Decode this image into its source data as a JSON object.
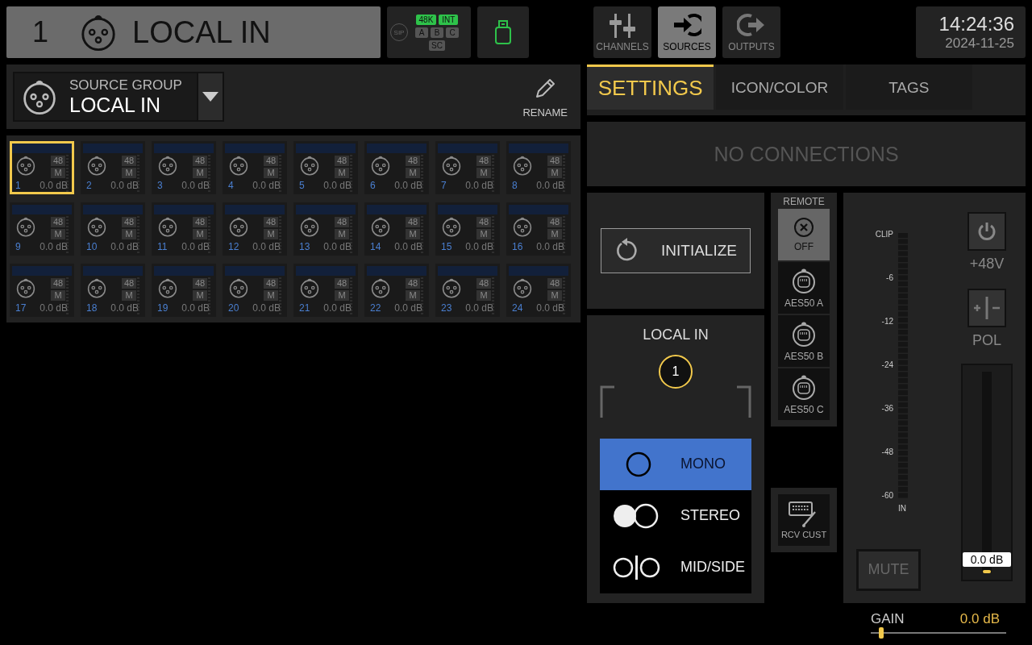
{
  "header": {
    "channel_number": "1",
    "channel_name": "LOCAL IN"
  },
  "status": {
    "sip": "SIP",
    "badges": [
      {
        "label": "48K",
        "on": true
      },
      {
        "label": "INT",
        "on": true
      },
      {
        "label": "A",
        "on": false
      },
      {
        "label": "B",
        "on": false
      },
      {
        "label": "C",
        "on": false
      },
      {
        "label": "SC",
        "on": false
      }
    ]
  },
  "nav": [
    {
      "label": "CHANNELS",
      "kind": "channels",
      "selected": false
    },
    {
      "label": "SOURCES",
      "kind": "sources",
      "selected": true
    },
    {
      "label": "OUTPUTS",
      "kind": "outputs",
      "selected": false
    }
  ],
  "clock": {
    "time": "14:24:36",
    "date": "2024-11-25"
  },
  "source_group": {
    "caption": "SOURCE GROUP",
    "value": "LOCAL IN",
    "rename": "RENAME"
  },
  "inputs": [
    {
      "number": "1",
      "phantom": "48",
      "mode": "M",
      "gain": "0.0 dB",
      "selected": true
    },
    {
      "number": "2",
      "phantom": "48",
      "mode": "M",
      "gain": "0.0 dB",
      "selected": false
    },
    {
      "number": "3",
      "phantom": "48",
      "mode": "M",
      "gain": "0.0 dB",
      "selected": false
    },
    {
      "number": "4",
      "phantom": "48",
      "mode": "M",
      "gain": "0.0 dB",
      "selected": false
    },
    {
      "number": "5",
      "phantom": "48",
      "mode": "M",
      "gain": "0.0 dB",
      "selected": false
    },
    {
      "number": "6",
      "phantom": "48",
      "mode": "M",
      "gain": "0.0 dB",
      "selected": false
    },
    {
      "number": "7",
      "phantom": "48",
      "mode": "M",
      "gain": "0.0 dB",
      "selected": false
    },
    {
      "number": "8",
      "phantom": "48",
      "mode": "M",
      "gain": "0.0 dB",
      "selected": false
    },
    {
      "number": "9",
      "phantom": "48",
      "mode": "M",
      "gain": "0.0 dB",
      "selected": false
    },
    {
      "number": "10",
      "phantom": "48",
      "mode": "M",
      "gain": "0.0 dB",
      "selected": false
    },
    {
      "number": "11",
      "phantom": "48",
      "mode": "M",
      "gain": "0.0 dB",
      "selected": false
    },
    {
      "number": "12",
      "phantom": "48",
      "mode": "M",
      "gain": "0.0 dB",
      "selected": false
    },
    {
      "number": "13",
      "phantom": "48",
      "mode": "M",
      "gain": "0.0 dB",
      "selected": false
    },
    {
      "number": "14",
      "phantom": "48",
      "mode": "M",
      "gain": "0.0 dB",
      "selected": false
    },
    {
      "number": "15",
      "phantom": "48",
      "mode": "M",
      "gain": "0.0 dB",
      "selected": false
    },
    {
      "number": "16",
      "phantom": "48",
      "mode": "M",
      "gain": "0.0 dB",
      "selected": false
    },
    {
      "number": "17",
      "phantom": "48",
      "mode": "M",
      "gain": "0.0 dB",
      "selected": false
    },
    {
      "number": "18",
      "phantom": "48",
      "mode": "M",
      "gain": "0.0 dB",
      "selected": false
    },
    {
      "number": "19",
      "phantom": "48",
      "mode": "M",
      "gain": "0.0 dB",
      "selected": false
    },
    {
      "number": "20",
      "phantom": "48",
      "mode": "M",
      "gain": "0.0 dB",
      "selected": false
    },
    {
      "number": "21",
      "phantom": "48",
      "mode": "M",
      "gain": "0.0 dB",
      "selected": false
    },
    {
      "number": "22",
      "phantom": "48",
      "mode": "M",
      "gain": "0.0 dB",
      "selected": false
    },
    {
      "number": "23",
      "phantom": "48",
      "mode": "M",
      "gain": "0.0 dB",
      "selected": false
    },
    {
      "number": "24",
      "phantom": "48",
      "mode": "M",
      "gain": "0.0 dB",
      "selected": false
    }
  ],
  "tabs": [
    {
      "label": "SETTINGS",
      "selected": true
    },
    {
      "label": "ICON/COLOR",
      "selected": false
    },
    {
      "label": "TAGS",
      "selected": false
    }
  ],
  "connections": "NO CONNECTIONS",
  "initialize": "INITIALIZE",
  "source": {
    "title": "LOCAL IN",
    "socket": "1",
    "modes": [
      {
        "label": "MONO",
        "kind": "mono",
        "selected": true
      },
      {
        "label": "STEREO",
        "kind": "stereo",
        "selected": false
      },
      {
        "label": "MID/SIDE",
        "kind": "midside",
        "selected": false
      }
    ]
  },
  "remote": {
    "title": "REMOTE",
    "options": [
      {
        "label": "OFF",
        "kind": "off",
        "selected": true
      },
      {
        "label": "AES50 A",
        "kind": "aes50",
        "selected": false
      },
      {
        "label": "AES50 B",
        "kind": "aes50",
        "selected": false
      },
      {
        "label": "AES50 C",
        "kind": "aes50",
        "selected": false
      }
    ]
  },
  "rcv_cust": "RCV CUST",
  "meter": {
    "scale": [
      "CLIP",
      "-6",
      "-12",
      "-24",
      "-36",
      "-48",
      "-60"
    ],
    "label": "IN"
  },
  "phantom": {
    "label": "+48V",
    "on": false
  },
  "polarity": {
    "label": "POL",
    "on": false
  },
  "mute": {
    "label": "MUTE",
    "on": false
  },
  "fader": {
    "reading": "0.0 dB",
    "level": 0.0
  },
  "gain": {
    "label": "GAIN",
    "reading": "0.0 dB",
    "level": 0.06
  }
}
